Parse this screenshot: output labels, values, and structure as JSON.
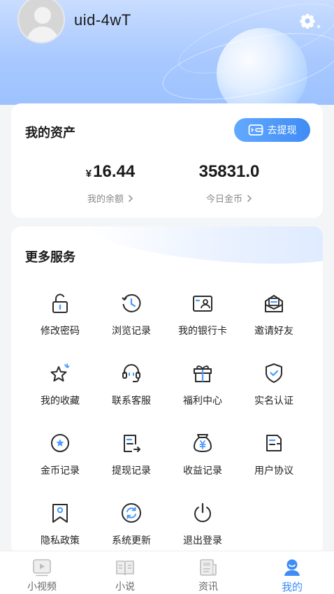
{
  "profile": {
    "username": "uid-4wT"
  },
  "assets": {
    "title": "我的资产",
    "withdraw_label": "去提现",
    "balance_currency": "¥",
    "balance_value": "16.44",
    "balance_label": "我的余额",
    "coins_value": "35831.0",
    "coins_label": "今日金币"
  },
  "services": {
    "title": "更多服务",
    "items": [
      {
        "label": "修改密码",
        "icon": "unlock-icon"
      },
      {
        "label": "浏览记录",
        "icon": "history-icon"
      },
      {
        "label": "我的银行卡",
        "icon": "bank-card-icon"
      },
      {
        "label": "邀请好友",
        "icon": "invite-envelope-icon"
      },
      {
        "label": "我的收藏",
        "icon": "star-icon"
      },
      {
        "label": "联系客服",
        "icon": "headset-icon"
      },
      {
        "label": "福利中心",
        "icon": "gift-icon"
      },
      {
        "label": "实名认证",
        "icon": "shield-check-icon"
      },
      {
        "label": "金币记录",
        "icon": "coin-icon"
      },
      {
        "label": "提现记录",
        "icon": "withdraw-doc-icon"
      },
      {
        "label": "收益记录",
        "icon": "money-bag-icon"
      },
      {
        "label": "用户协议",
        "icon": "agreement-doc-icon"
      },
      {
        "label": "隐私政策",
        "icon": "bookmark-icon"
      },
      {
        "label": "系统更新",
        "icon": "refresh-icon"
      },
      {
        "label": "退出登录",
        "icon": "power-icon"
      }
    ]
  },
  "tabbar": {
    "tabs": [
      {
        "label": "小视频",
        "icon": "video-icon"
      },
      {
        "label": "小说",
        "icon": "book-icon"
      },
      {
        "label": "资讯",
        "icon": "news-icon"
      },
      {
        "label": "我的",
        "icon": "user-icon"
      }
    ],
    "active_index": 3
  },
  "colors": {
    "accent": "#3f8cf5",
    "header_light": "#c9ddff",
    "header_dark": "#9cc2ff"
  }
}
